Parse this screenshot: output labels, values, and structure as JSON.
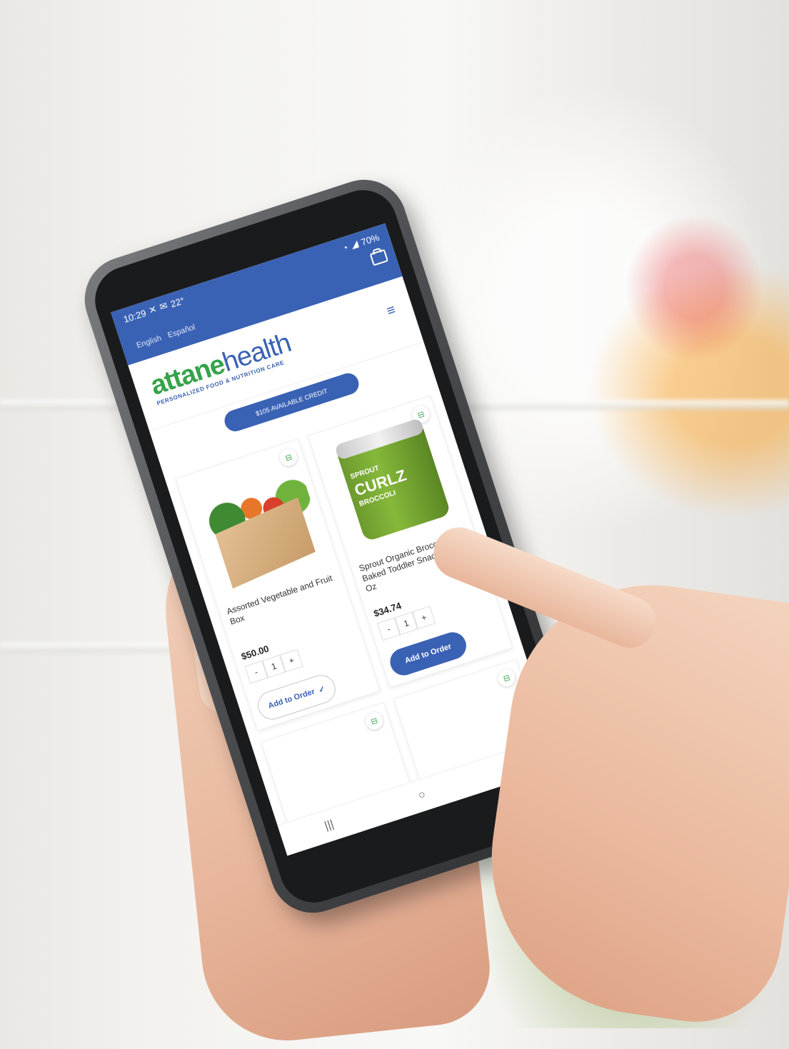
{
  "status": {
    "time": "10:29",
    "temp": "22°",
    "battery": "70%"
  },
  "languages": [
    "English",
    "Español"
  ],
  "brand": {
    "name_left": "attane",
    "name_right": "health",
    "tagline": "PERSONALIZED FOOD & NUTRITION CARE"
  },
  "credit_label": "$105 AVAILABLE CREDIT",
  "products": [
    {
      "name": "Assorted Vegetable and Fruit Box",
      "price": "$50.00",
      "qty": "1",
      "button": "Add to Order",
      "state": "added"
    },
    {
      "name": "Sprout Organic Broccoli Curlz Baked Toddler Snacks – 1.48 Oz",
      "price": "$34.74",
      "qty": "1",
      "button": "Add to Order",
      "state": "default"
    }
  ],
  "can_label": {
    "brand": "SPROUT",
    "product": "CURLZ",
    "flavor": "BROCCOLI"
  },
  "colors": {
    "primary": "#3a62b4",
    "brand_green": "#35a34a"
  },
  "icons": [
    "cart-icon",
    "menu-icon",
    "basket-badge-icon",
    "check-icon"
  ]
}
